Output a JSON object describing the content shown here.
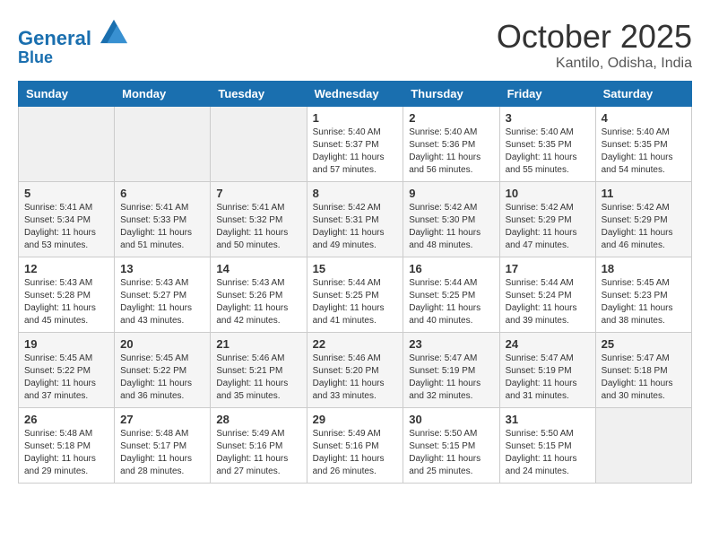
{
  "header": {
    "logo_line1": "General",
    "logo_line2": "Blue",
    "month": "October 2025",
    "location": "Kantilo, Odisha, India"
  },
  "weekdays": [
    "Sunday",
    "Monday",
    "Tuesday",
    "Wednesday",
    "Thursday",
    "Friday",
    "Saturday"
  ],
  "weeks": [
    [
      {
        "day": "",
        "empty": true
      },
      {
        "day": "",
        "empty": true
      },
      {
        "day": "",
        "empty": true
      },
      {
        "day": "1",
        "sunrise": "5:40 AM",
        "sunset": "5:37 PM",
        "daylight": "11 hours and 57 minutes."
      },
      {
        "day": "2",
        "sunrise": "5:40 AM",
        "sunset": "5:36 PM",
        "daylight": "11 hours and 56 minutes."
      },
      {
        "day": "3",
        "sunrise": "5:40 AM",
        "sunset": "5:35 PM",
        "daylight": "11 hours and 55 minutes."
      },
      {
        "day": "4",
        "sunrise": "5:40 AM",
        "sunset": "5:35 PM",
        "daylight": "11 hours and 54 minutes."
      }
    ],
    [
      {
        "day": "5",
        "sunrise": "5:41 AM",
        "sunset": "5:34 PM",
        "daylight": "11 hours and 53 minutes."
      },
      {
        "day": "6",
        "sunrise": "5:41 AM",
        "sunset": "5:33 PM",
        "daylight": "11 hours and 51 minutes."
      },
      {
        "day": "7",
        "sunrise": "5:41 AM",
        "sunset": "5:32 PM",
        "daylight": "11 hours and 50 minutes."
      },
      {
        "day": "8",
        "sunrise": "5:42 AM",
        "sunset": "5:31 PM",
        "daylight": "11 hours and 49 minutes."
      },
      {
        "day": "9",
        "sunrise": "5:42 AM",
        "sunset": "5:30 PM",
        "daylight": "11 hours and 48 minutes."
      },
      {
        "day": "10",
        "sunrise": "5:42 AM",
        "sunset": "5:29 PM",
        "daylight": "11 hours and 47 minutes."
      },
      {
        "day": "11",
        "sunrise": "5:42 AM",
        "sunset": "5:29 PM",
        "daylight": "11 hours and 46 minutes."
      }
    ],
    [
      {
        "day": "12",
        "sunrise": "5:43 AM",
        "sunset": "5:28 PM",
        "daylight": "11 hours and 45 minutes."
      },
      {
        "day": "13",
        "sunrise": "5:43 AM",
        "sunset": "5:27 PM",
        "daylight": "11 hours and 43 minutes."
      },
      {
        "day": "14",
        "sunrise": "5:43 AM",
        "sunset": "5:26 PM",
        "daylight": "11 hours and 42 minutes."
      },
      {
        "day": "15",
        "sunrise": "5:44 AM",
        "sunset": "5:25 PM",
        "daylight": "11 hours and 41 minutes."
      },
      {
        "day": "16",
        "sunrise": "5:44 AM",
        "sunset": "5:25 PM",
        "daylight": "11 hours and 40 minutes."
      },
      {
        "day": "17",
        "sunrise": "5:44 AM",
        "sunset": "5:24 PM",
        "daylight": "11 hours and 39 minutes."
      },
      {
        "day": "18",
        "sunrise": "5:45 AM",
        "sunset": "5:23 PM",
        "daylight": "11 hours and 38 minutes."
      }
    ],
    [
      {
        "day": "19",
        "sunrise": "5:45 AM",
        "sunset": "5:22 PM",
        "daylight": "11 hours and 37 minutes."
      },
      {
        "day": "20",
        "sunrise": "5:45 AM",
        "sunset": "5:22 PM",
        "daylight": "11 hours and 36 minutes."
      },
      {
        "day": "21",
        "sunrise": "5:46 AM",
        "sunset": "5:21 PM",
        "daylight": "11 hours and 35 minutes."
      },
      {
        "day": "22",
        "sunrise": "5:46 AM",
        "sunset": "5:20 PM",
        "daylight": "11 hours and 33 minutes."
      },
      {
        "day": "23",
        "sunrise": "5:47 AM",
        "sunset": "5:19 PM",
        "daylight": "11 hours and 32 minutes."
      },
      {
        "day": "24",
        "sunrise": "5:47 AM",
        "sunset": "5:19 PM",
        "daylight": "11 hours and 31 minutes."
      },
      {
        "day": "25",
        "sunrise": "5:47 AM",
        "sunset": "5:18 PM",
        "daylight": "11 hours and 30 minutes."
      }
    ],
    [
      {
        "day": "26",
        "sunrise": "5:48 AM",
        "sunset": "5:18 PM",
        "daylight": "11 hours and 29 minutes."
      },
      {
        "day": "27",
        "sunrise": "5:48 AM",
        "sunset": "5:17 PM",
        "daylight": "11 hours and 28 minutes."
      },
      {
        "day": "28",
        "sunrise": "5:49 AM",
        "sunset": "5:16 PM",
        "daylight": "11 hours and 27 minutes."
      },
      {
        "day": "29",
        "sunrise": "5:49 AM",
        "sunset": "5:16 PM",
        "daylight": "11 hours and 26 minutes."
      },
      {
        "day": "30",
        "sunrise": "5:50 AM",
        "sunset": "5:15 PM",
        "daylight": "11 hours and 25 minutes."
      },
      {
        "day": "31",
        "sunrise": "5:50 AM",
        "sunset": "5:15 PM",
        "daylight": "11 hours and 24 minutes."
      },
      {
        "day": "",
        "empty": true
      }
    ]
  ]
}
